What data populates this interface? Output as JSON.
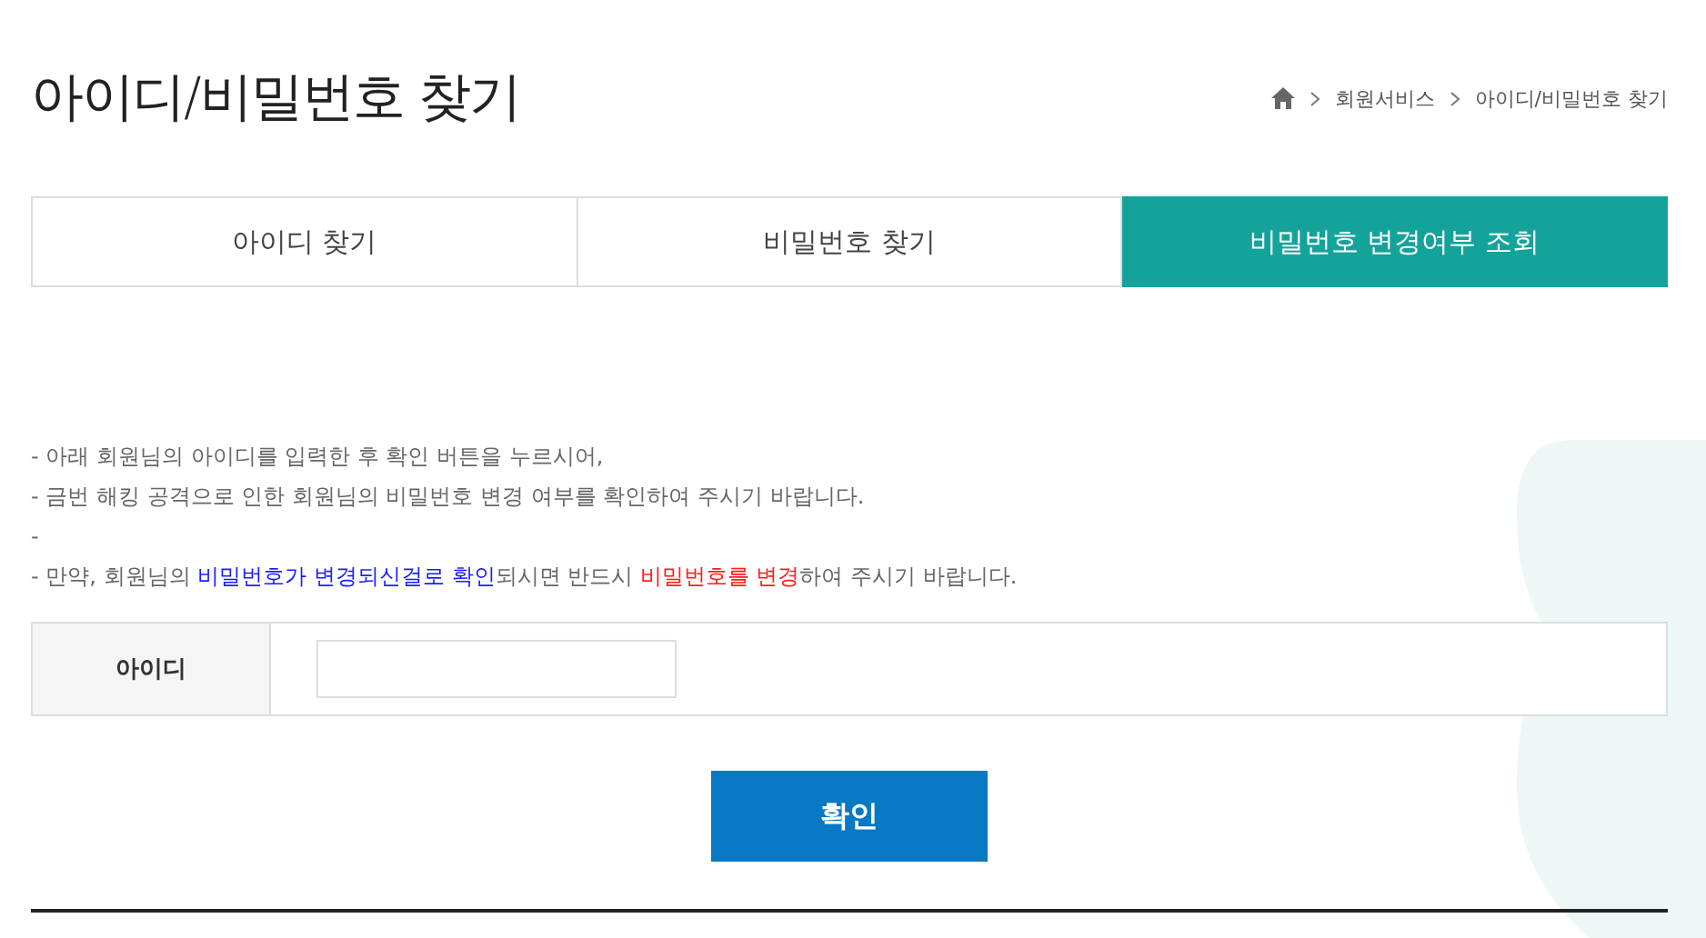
{
  "page_title": "아이디/비밀번호 찾기",
  "breadcrumb": [
    "회원서비스",
    "아이디/비밀번호 찾기"
  ],
  "tabs": [
    {
      "label": "아이디 찾기",
      "selected": false
    },
    {
      "label": "비밀번호 찾기",
      "selected": false
    },
    {
      "label": "비밀번호 변경여부 조회",
      "selected": true
    }
  ],
  "notices": [
    {
      "bullet": "-",
      "segments": [
        {
          "kind": "plain",
          "text": "아래 회원님의 아이디를 입력한 후 확인 버튼을 누르시어,"
        }
      ]
    },
    {
      "bullet": "-",
      "segments": [
        {
          "kind": "plain",
          "text": "금번 해킹 공격으로 인한 회원님의 비밀번호 변경 여부를 확인하여 주시기 바랍니다."
        }
      ]
    },
    {
      "bullet": "-"
    },
    {
      "bullet": "-",
      "segments": [
        {
          "kind": "plain",
          "text": "만약, 회원님의 "
        },
        {
          "kind": "highlight",
          "text": "비밀번호가 변경되신걸로 확인"
        },
        {
          "kind": "plain",
          "text": "되시면 반드시 "
        },
        {
          "kind": "warning",
          "text": "비밀번호를 변경"
        },
        {
          "kind": "plain",
          "text": "하여 주시기 바랍니다."
        }
      ]
    }
  ],
  "form": {
    "label": "아이디"
  },
  "confirm_button": "확인"
}
